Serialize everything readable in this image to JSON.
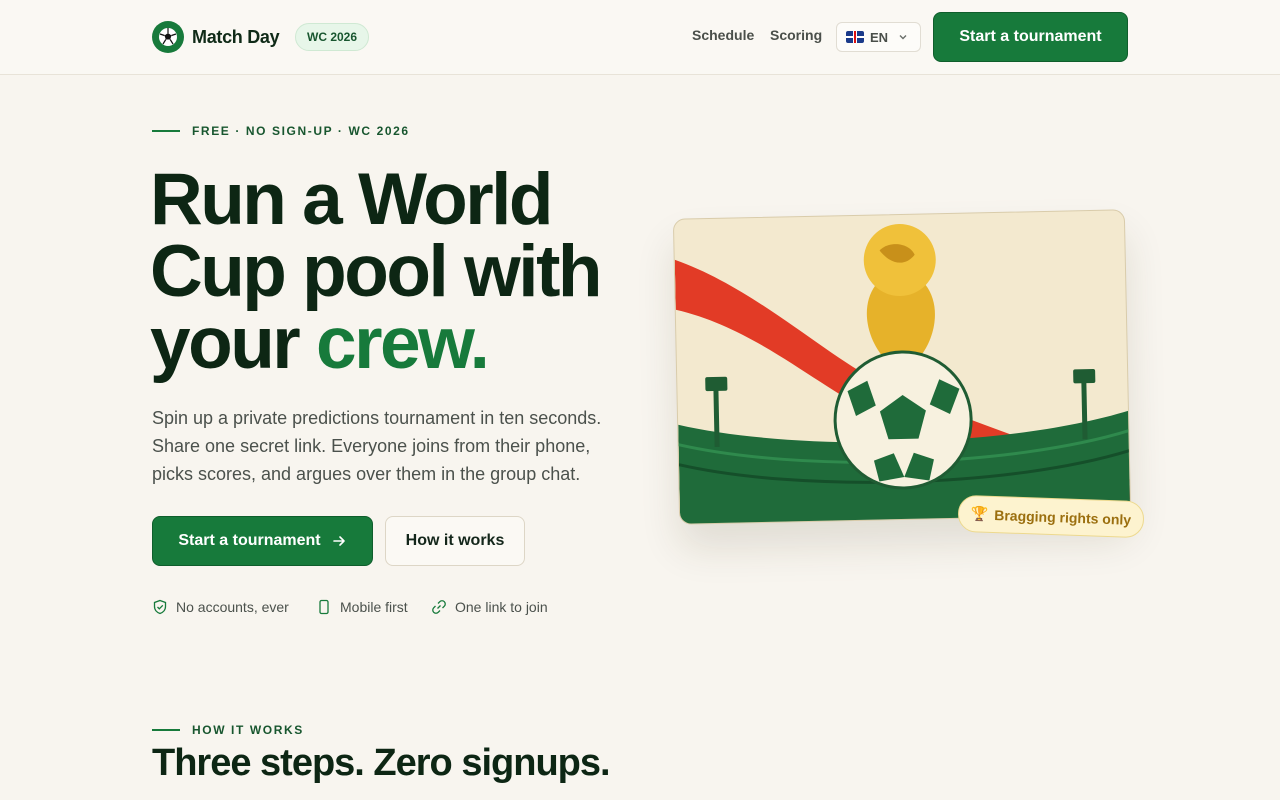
{
  "header": {
    "brand": "Match Day",
    "badge": "WC 2026",
    "nav": [
      {
        "label": "Schedule"
      },
      {
        "label": "Scoring"
      }
    ],
    "language": "EN",
    "cta": "Start a tournament"
  },
  "hero": {
    "eyebrow": "FREE · NO SIGN-UP · WC 2026",
    "title_line1": "Run a World",
    "title_line2": "Cup pool with",
    "title_line3_plain": "your ",
    "title_line3_accent": "crew.",
    "subtitle": "Spin up a private predictions tournament in ten seconds. Share one secret link. Everyone joins from their phone, picks scores, and argues over them in the group chat.",
    "primary_button": "Start a tournament",
    "secondary_button": "How it works",
    "features": [
      {
        "label": "No accounts, ever",
        "icon": "shield-check-icon"
      },
      {
        "label": "Mobile first",
        "icon": "phone-icon"
      },
      {
        "label": "One link to join",
        "icon": "link-icon"
      }
    ],
    "card_badge": "Bragging rights only",
    "card_badge_icon": "🏆"
  },
  "how_it_works": {
    "eyebrow": "HOW IT WORKS",
    "title": "Three steps. Zero signups."
  },
  "colors": {
    "brand_green": "#177a3b",
    "background": "#f8f5ef",
    "accent_red": "#e23b26",
    "trophy_gold": "#e6b22a"
  }
}
